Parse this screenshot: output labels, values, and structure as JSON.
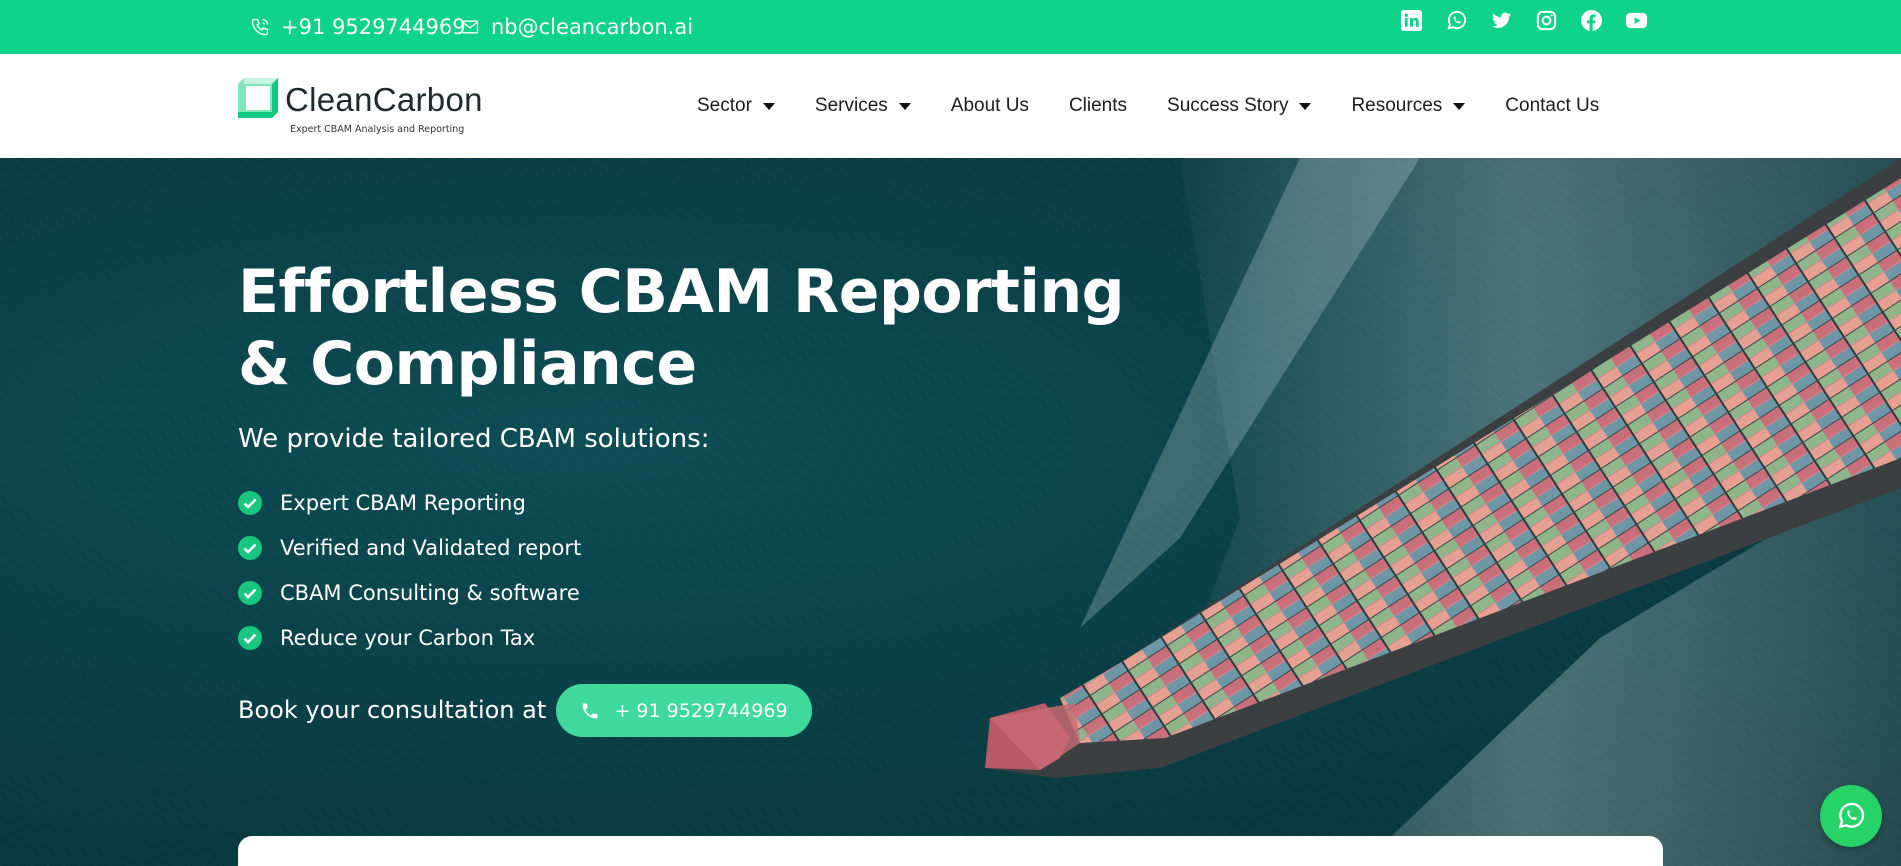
{
  "topbar": {
    "phone": "+91 9529744969",
    "email": "nb@cleancarbon.ai",
    "socials": [
      "linkedin-icon",
      "whatsapp-icon",
      "twitter-icon",
      "instagram-icon",
      "facebook-icon",
      "youtube-icon"
    ]
  },
  "brand": {
    "name": "CleanCarbon",
    "tagline": "Expert CBAM Analysis and Reporting",
    "accent": "#10d38a"
  },
  "nav": {
    "items": [
      {
        "label": "Sector",
        "dropdown": true
      },
      {
        "label": "Services",
        "dropdown": true
      },
      {
        "label": "About Us",
        "dropdown": false
      },
      {
        "label": "Clients",
        "dropdown": false
      },
      {
        "label": "Success Story",
        "dropdown": true
      },
      {
        "label": "Resources",
        "dropdown": true
      },
      {
        "label": "Contact Us",
        "dropdown": false
      }
    ]
  },
  "hero": {
    "title": "Effortless CBAM Reporting & Compliance",
    "subtitle": "We provide tailored CBAM solutions:",
    "features": [
      "Expert CBAM Reporting",
      "Verified and Validated report",
      "CBAM Consulting & software",
      "Reduce your Carbon Tax"
    ],
    "book_text": "Book your consultation at",
    "cta_label": "+ 91 9529744969"
  },
  "colors": {
    "topbar": "#10d38a",
    "cta": "#3fd99c",
    "check": "#18c77f",
    "sea": "#0b3f47"
  }
}
